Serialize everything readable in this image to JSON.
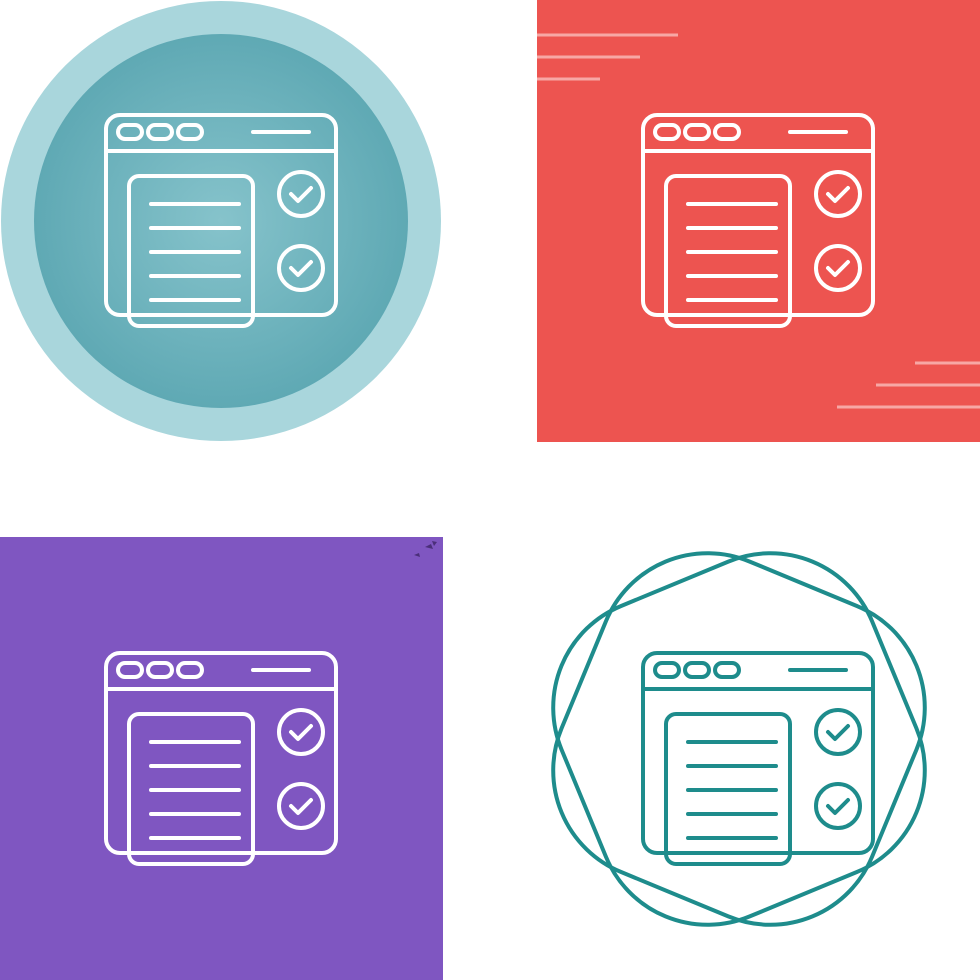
{
  "colors": {
    "circle_outer": "#a9d6dc",
    "circle_inner": "#68b1bb",
    "red_square": "#ed5450",
    "red_stripes": "#f7a7a5",
    "purple_square": "#7f56c1",
    "teal_stroke": "#1e8c8c",
    "white_stroke": "#ffffff"
  },
  "icons": [
    {
      "name": "browser-checklist-icon",
      "variant": "circle-gradient"
    },
    {
      "name": "browser-checklist-icon",
      "variant": "red-square"
    },
    {
      "name": "browser-checklist-icon",
      "variant": "purple-square"
    },
    {
      "name": "browser-checklist-icon",
      "variant": "outline-badge"
    }
  ]
}
